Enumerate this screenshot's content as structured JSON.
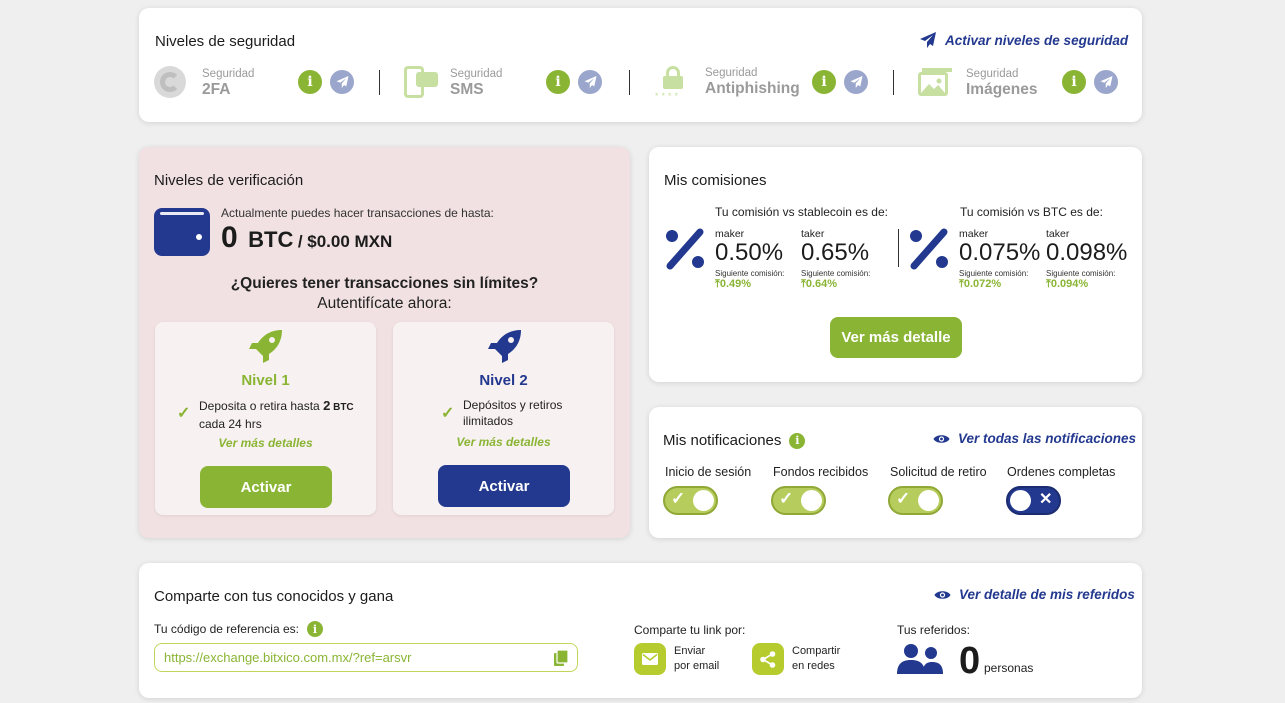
{
  "security": {
    "title": "Niveles de seguridad",
    "activate_link": "Activar niveles de seguridad",
    "items": [
      {
        "label": "Seguridad",
        "name": "2FA"
      },
      {
        "label": "Seguridad",
        "name": "SMS"
      },
      {
        "label": "Seguridad",
        "name": "Antiphishing"
      },
      {
        "label": "Seguridad",
        "name": "Imágenes"
      }
    ]
  },
  "verification": {
    "title": "Niveles de verificación",
    "limit_text": "Actualmente puedes hacer transacciones de hasta:",
    "amount": "0",
    "currency": "BTC",
    "fiat": "/ $0.00 MXN",
    "question": "¿Quieres tener transacciones sin límites?",
    "auth_now": "Autentifícate ahora:",
    "levels": [
      {
        "name": "Nivel 1",
        "desc_pre": "Deposita o retira hasta ",
        "desc_bold": "2",
        "desc_unit": " BTC",
        "desc_post": "cada 24 hrs",
        "details": "Ver más detalles",
        "button": "Activar"
      },
      {
        "name": "Nivel 2",
        "desc_pre": "Depósitos y retiros",
        "desc_post": "ilimitados",
        "details": "Ver más detalles",
        "button": "Activar"
      }
    ]
  },
  "commissions": {
    "title": "Mis comisiones",
    "stable_heading": "Tu comisión vs stablecoin es de:",
    "btc_heading": "Tu comisión vs BTC es de:",
    "maker_label": "maker",
    "taker_label": "taker",
    "next_label": "Siguiente comisión:",
    "stable_maker": "0.50%",
    "stable_taker": "0.65%",
    "stable_maker_next": "0.49%",
    "stable_taker_next": "0.64%",
    "btc_maker": "0.075%",
    "btc_taker": "0.098%",
    "btc_maker_next": "0.072%",
    "btc_taker_next": "0.094%",
    "detail_button": "Ver más detalle"
  },
  "notifications": {
    "title": "Mis notificaciones",
    "view_all": "Ver todas las notificaciones",
    "items": [
      {
        "label": "Inicio de sesión",
        "on": true
      },
      {
        "label": "Fondos recibidos",
        "on": true
      },
      {
        "label": "Solicitud de retiro",
        "on": true
      },
      {
        "label": "Ordenes completas",
        "on": false
      }
    ]
  },
  "referral": {
    "title": "Comparte con tus conocidos y gana",
    "detail_link": "Ver detalle de mis referidos",
    "code_label": "Tu código de referencia es:",
    "code_value": "https://exchange.bitxico.com.mx/?ref=arsvr",
    "share_label": "Comparte tu link por:",
    "email_l1": "Enviar",
    "email_l2": "por email",
    "social_l1": "Compartir",
    "social_l2": "en redes",
    "referrals_label": "Tus referidos:",
    "referrals_count": "0",
    "referrals_unit": "personas"
  },
  "colors": {
    "green": "#8ab534",
    "blue": "#23398f",
    "pink_bg": "#f1e1e2",
    "lavender": "#9aa6cc"
  }
}
